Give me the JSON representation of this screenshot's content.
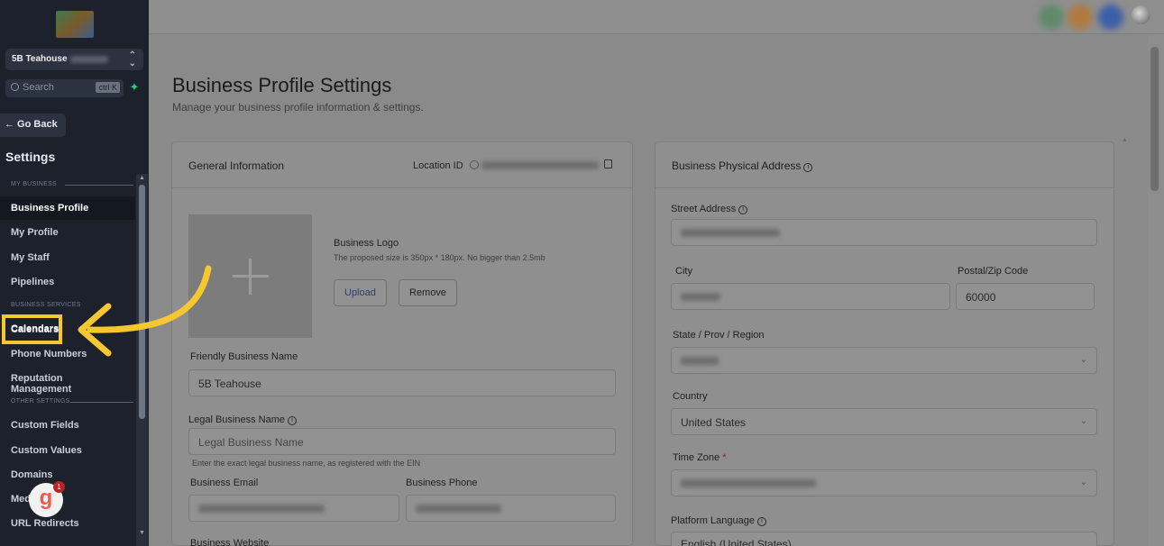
{
  "sidebar": {
    "location_name": "5B Teahouse",
    "search_placeholder": "Search",
    "search_shortcut": "ctrl K",
    "go_back": "← Go Back",
    "settings_title": "Settings",
    "sections": {
      "my_business": "MY BUSINESS",
      "business_services": "BUSINESS SERVICES",
      "other_settings": "OTHER SETTINGS"
    },
    "items": {
      "business_profile": "Business Profile",
      "my_profile": "My Profile",
      "my_staff": "My Staff",
      "pipelines": "Pipelines",
      "calendars": "Calendars",
      "phone_numbers": "Phone Numbers",
      "reputation": "Reputation Management",
      "custom_fields": "Custom Fields",
      "custom_values": "Custom Values",
      "domains": "Domains",
      "media": "Media",
      "url_redirects": "URL Redirects"
    },
    "badge_letter": "g",
    "badge_count": "1"
  },
  "page": {
    "title": "Business Profile Settings",
    "subtitle": "Manage your business profile information & settings."
  },
  "general": {
    "title": "General Information",
    "location_id_label": "Location ID",
    "logo_label": "Business Logo",
    "logo_hint": "The proposed size is 350px * 180px. No bigger than 2.5mb",
    "upload": "Upload",
    "remove": "Remove",
    "friendly_name_label": "Friendly Business Name",
    "friendly_name_value": "5B Teahouse",
    "legal_name_label": "Legal Business Name",
    "legal_name_placeholder": "Legal Business Name",
    "legal_name_hint": "Enter the exact legal business name, as registered with the EIN",
    "email_label": "Business Email",
    "phone_label": "Business Phone",
    "website_label": "Business Website"
  },
  "address": {
    "title": "Business Physical Address",
    "street_label": "Street Address",
    "city_label": "City",
    "zip_label": "Postal/Zip Code",
    "zip_value": "60000",
    "state_label": "State / Prov / Region",
    "country_label": "Country",
    "country_value": "United States",
    "timezone_label": "Time Zone",
    "timezone_required": "*",
    "language_label": "Platform Language",
    "language_value": "English (United States)"
  },
  "colors": {
    "highlight": "#f7c72f",
    "sidebar_bg": "#1c212c",
    "accent_green": "#31c96b"
  }
}
